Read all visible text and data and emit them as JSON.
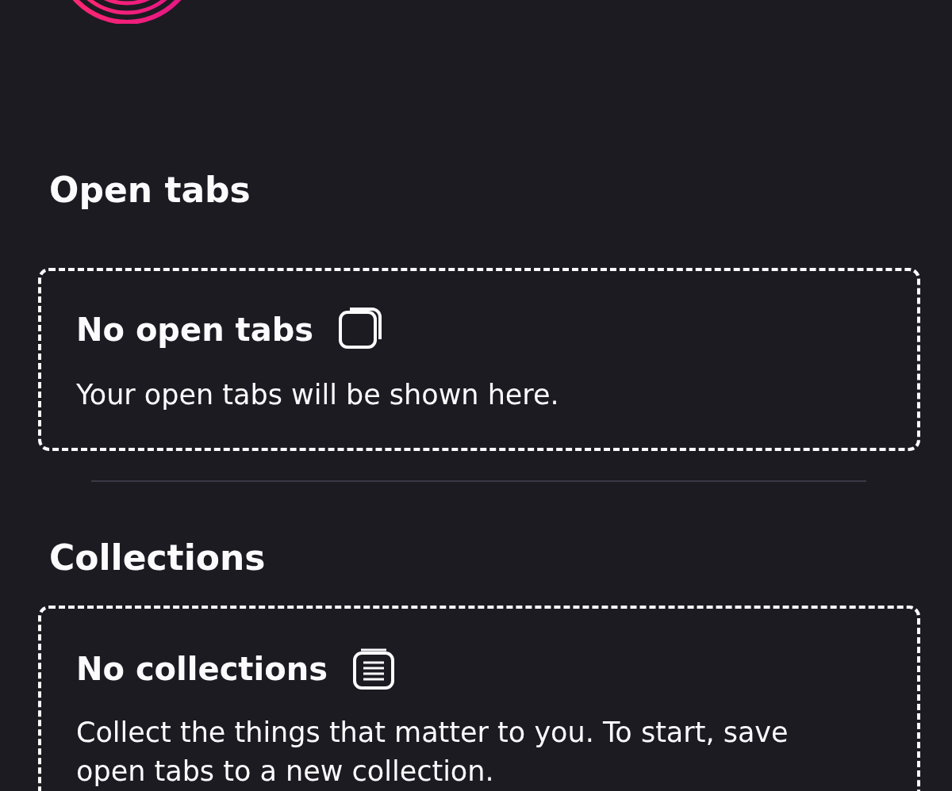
{
  "sections": [
    {
      "heading": "Open tabs",
      "empty": {
        "title": "No open tabs",
        "text": "Your open tabs will be shown here."
      }
    },
    {
      "heading": "Collections",
      "empty": {
        "title": "No collections",
        "text": "Collect the things that matter to you. To start, save open tabs to a new collection."
      }
    }
  ]
}
